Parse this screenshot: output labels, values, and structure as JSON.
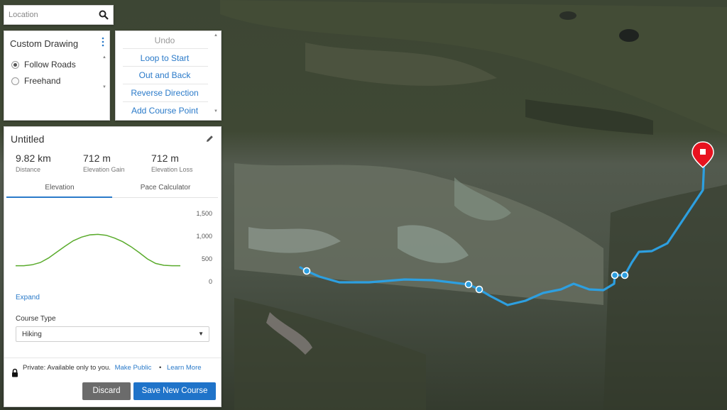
{
  "search": {
    "placeholder": "Location",
    "icon": "search-icon"
  },
  "drawing": {
    "title": "Custom Drawing",
    "options": [
      {
        "label": "Follow Roads",
        "selected": true
      },
      {
        "label": "Freehand",
        "selected": false
      }
    ]
  },
  "actions": {
    "undo": "Undo",
    "loop": "Loop to Start",
    "out_back": "Out and Back",
    "reverse": "Reverse Direction",
    "add_point": "Add Course Point"
  },
  "course": {
    "title": "Untitled",
    "stats": [
      {
        "value": "9.82 km",
        "label": "Distance"
      },
      {
        "value": "712 m",
        "label": "Elevation Gain"
      },
      {
        "value": "712 m",
        "label": "Elevation Loss"
      }
    ],
    "tabs": {
      "elevation": "Elevation",
      "pace": "Pace Calculator",
      "active": "Elevation"
    },
    "expand": "Expand",
    "course_type_label": "Course Type",
    "course_type_value": "Hiking",
    "privacy_text": "Private: Available only to you.",
    "make_public": "Make Public",
    "bullet": "•",
    "learn_more": "Learn More",
    "discard": "Discard",
    "save": "Save New Course"
  },
  "chart_data": {
    "type": "line",
    "title": "",
    "xlabel": "",
    "ylabel": "",
    "ylim": [
      0,
      1500
    ],
    "yticks": [
      "1,500",
      "1,000",
      "500",
      "0"
    ],
    "grid": false,
    "color": "#5aab2c",
    "series": [
      {
        "values": [
          350,
          350,
          370,
          420,
          520,
          650,
          780,
          900,
          980,
          1030,
          1040,
          1020,
          960,
          880,
          770,
          640,
          500,
          400,
          360,
          350,
          350
        ]
      }
    ]
  },
  "colors": {
    "accent": "#2a7ac9",
    "route": "#2d9fe0",
    "marker": "#e8121f"
  }
}
